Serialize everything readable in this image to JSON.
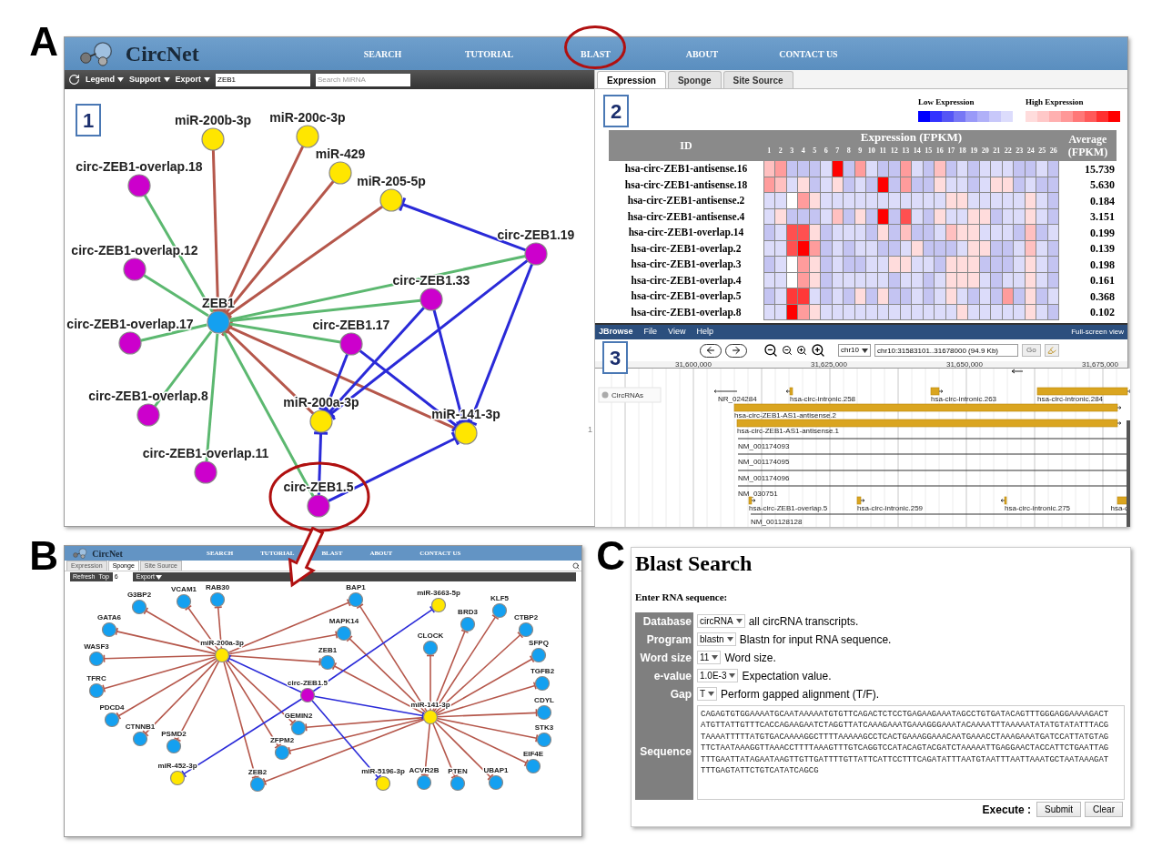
{
  "panel_a": {
    "letter": "A",
    "header": {
      "logo": "CircNet",
      "nav": [
        {
          "label": "SEARCH",
          "circled": false
        },
        {
          "label": "TUTORIAL",
          "circled": false
        },
        {
          "label": "BLAST",
          "circled": true
        },
        {
          "label": "ABOUT",
          "circled": false
        },
        {
          "label": "CONTACT US",
          "circled": false
        }
      ]
    },
    "toolbar": {
      "menus": [
        "Legend",
        "Support",
        "Export"
      ],
      "gene_field": {
        "value": "ZEB1"
      },
      "mirna_field": {
        "placeholder": "Search MiRNA"
      }
    },
    "network": {
      "box_label": "1",
      "edge_mark": "1",
      "nodes": [
        {
          "label": "miR-200b-3p",
          "color": "#ffe600",
          "circled": false
        },
        {
          "label": "miR-200c-3p",
          "color": "#ffe600",
          "circled": false
        },
        {
          "label": "miR-429",
          "color": "#ffe600",
          "circled": false
        },
        {
          "label": "miR-205-5p",
          "color": "#ffe600",
          "circled": false
        },
        {
          "label": "circ-ZEB1-overlap.18",
          "color": "#cc00cc",
          "circled": false
        },
        {
          "label": "circ-ZEB1-overlap.12",
          "color": "#cc00cc",
          "circled": false
        },
        {
          "label": "ZEB1",
          "color": "#14a0f0",
          "circled": false
        },
        {
          "label": "circ-ZEB1.19",
          "color": "#cc00cc",
          "circled": false
        },
        {
          "label": "circ-ZEB1.33",
          "color": "#cc00cc",
          "circled": false
        },
        {
          "label": "circ-ZEB1-overlap.17",
          "color": "#cc00cc",
          "circled": false
        },
        {
          "label": "circ-ZEB1.17",
          "color": "#cc00cc",
          "circled": false
        },
        {
          "label": "circ-ZEB1-overlap.8",
          "color": "#cc00cc",
          "circled": false
        },
        {
          "label": "miR-200a-3p",
          "color": "#ffe600",
          "circled": false
        },
        {
          "label": "miR-141-3p",
          "color": "#ffe600",
          "circled": false
        },
        {
          "label": "circ-ZEB1-overlap.11",
          "color": "#cc00cc",
          "circled": false
        },
        {
          "label": "circ-ZEB1.5",
          "color": "#cc00cc",
          "circled": true
        }
      ],
      "edges": [
        {
          "kind": "targets"
        },
        {
          "kind": "targets"
        },
        {
          "kind": "targets"
        },
        {
          "kind": "targets"
        },
        {
          "kind": "targets"
        },
        {
          "kind": "targets"
        },
        {
          "kind": "coexpression"
        },
        {
          "kind": "coexpression"
        },
        {
          "kind": "coexpression"
        },
        {
          "kind": "coexpression"
        },
        {
          "kind": "coexpression"
        },
        {
          "kind": "coexpression"
        },
        {
          "kind": "coexpression"
        },
        {
          "kind": "coexpression"
        },
        {
          "kind": "coexpression"
        },
        {
          "kind": "sponge"
        },
        {
          "kind": "sponge"
        },
        {
          "kind": "sponge"
        },
        {
          "kind": "sponge"
        },
        {
          "kind": "sponge"
        },
        {
          "kind": "sponge"
        },
        {
          "kind": "sponge"
        },
        {
          "kind": "sponge"
        },
        {
          "kind": "sponge"
        }
      ]
    },
    "expression": {
      "tabs": [
        {
          "label": "Expression",
          "selected": true
        },
        {
          "label": "Sponge",
          "selected": false
        },
        {
          "label": "Site Source",
          "selected": false
        }
      ],
      "box_label": "2",
      "legend": [
        {
          "label": "Low Expression",
          "swatches": [
            {
              "color": "#0000ff"
            },
            {
              "color": "#3333ff"
            },
            {
              "color": "#5555f5"
            },
            {
              "color": "#7777f5"
            },
            {
              "color": "#9999f8"
            },
            {
              "color": "#b0b0f8"
            },
            {
              "color": "#c8c8fa"
            },
            {
              "color": "#dcdcfc"
            }
          ]
        },
        {
          "label": "High Expression",
          "swatches": [
            {
              "color": "#ffdcdc"
            },
            {
              "color": "#ffc8c8"
            },
            {
              "color": "#ffb0b0"
            },
            {
              "color": "#ff9898"
            },
            {
              "color": "#ff7878"
            },
            {
              "color": "#ff5a5a"
            },
            {
              "color": "#ff3030"
            },
            {
              "color": "#ff0000"
            }
          ]
        }
      ],
      "table": {
        "id_header": "ID",
        "expression_header": "Expression (FPKM)",
        "average_header": [
          "Average",
          "(FPKM)"
        ],
        "columns": [
          "1",
          "2",
          "3",
          "4",
          "5",
          "6",
          "7",
          "8",
          "9",
          "10",
          "11",
          "12",
          "13",
          "14",
          "15",
          "16",
          "17",
          "18",
          "19",
          "20",
          "21",
          "22",
          "23",
          "24",
          "25",
          "26"
        ],
        "rows": [
          {
            "id": "hsa-circ-ZEB1-antisense.16",
            "average": "15.739",
            "cells": [
              {
                "color": "#ffc0c0"
              },
              {
                "color": "#ff9c9c"
              },
              {
                "color": "#c4c4f2"
              },
              {
                "color": "#c4c4f2"
              },
              {
                "color": "#c4c4f2"
              },
              {
                "color": "#dcdcfa"
              },
              {
                "color": "#ff0000"
              },
              {
                "color": "#c4c4f2"
              },
              {
                "color": "#ff9c9c"
              },
              {
                "color": "#dcdcfa"
              },
              {
                "color": "#c4c4f2"
              },
              {
                "color": "#c4c4f2"
              },
              {
                "color": "#ff9c9c"
              },
              {
                "color": "#dcdcfa"
              },
              {
                "color": "#c4c4f2"
              },
              {
                "color": "#ffc0c0"
              },
              {
                "color": "#c4c4f2"
              },
              {
                "color": "#dcdcfa"
              },
              {
                "color": "#c4c4f2"
              },
              {
                "color": "#dcdcfa"
              },
              {
                "color": "#dcdcfa"
              },
              {
                "color": "#dcdcfa"
              },
              {
                "color": "#c4c4f2"
              },
              {
                "color": "#c4c4f2"
              },
              {
                "color": "#dcdcfa"
              },
              {
                "color": "#c4c4f2"
              }
            ]
          },
          {
            "id": "hsa-circ-ZEB1-antisense.18",
            "average": "5.630",
            "cells": [
              {
                "color": "#ff9c9c"
              },
              {
                "color": "#ffc0c0"
              },
              {
                "color": "#dcdcfa"
              },
              {
                "color": "#ffdcdc"
              },
              {
                "color": "#c4c4f2"
              },
              {
                "color": "#dcdcfa"
              },
              {
                "color": "#ffdcdc"
              },
              {
                "color": "#c4c4f2"
              },
              {
                "color": "#dcdcfa"
              },
              {
                "color": "#c4c4f2"
              },
              {
                "color": "#ff0000"
              },
              {
                "color": "#c4c4f2"
              },
              {
                "color": "#ff9c9c"
              },
              {
                "color": "#c4c4f2"
              },
              {
                "color": "#c4c4f2"
              },
              {
                "color": "#ffdcdc"
              },
              {
                "color": "#dcdcfa"
              },
              {
                "color": "#dcdcfa"
              },
              {
                "color": "#c4c4f2"
              },
              {
                "color": "#dcdcfa"
              },
              {
                "color": "#ffdcdc"
              },
              {
                "color": "#ffdcdc"
              },
              {
                "color": "#c4c4f2"
              },
              {
                "color": "#dcdcfa"
              },
              {
                "color": "#c4c4f2"
              },
              {
                "color": "#c4c4f2"
              }
            ]
          },
          {
            "id": "hsa-circ-ZEB1-antisense.2",
            "average": "0.184",
            "cells": [
              {
                "color": "#dcdcfa"
              },
              {
                "color": "#dcdcfa"
              },
              {
                "color": "#ffffff"
              },
              {
                "color": "#ff9c9c"
              },
              {
                "color": "#ffdcdc"
              },
              {
                "color": "#dcdcfa"
              },
              {
                "color": "#dcdcfa"
              },
              {
                "color": "#dcdcfa"
              },
              {
                "color": "#dcdcfa"
              },
              {
                "color": "#dcdcfa"
              },
              {
                "color": "#dcdcfa"
              },
              {
                "color": "#dcdcfa"
              },
              {
                "color": "#dcdcfa"
              },
              {
                "color": "#dcdcfa"
              },
              {
                "color": "#dcdcfa"
              },
              {
                "color": "#dcdcfa"
              },
              {
                "color": "#ffdcdc"
              },
              {
                "color": "#ffdcdc"
              },
              {
                "color": "#dcdcfa"
              },
              {
                "color": "#dcdcfa"
              },
              {
                "color": "#dcdcfa"
              },
              {
                "color": "#dcdcfa"
              },
              {
                "color": "#dcdcfa"
              },
              {
                "color": "#ffdcdc"
              },
              {
                "color": "#dcdcfa"
              },
              {
                "color": "#c4c4f2"
              }
            ]
          },
          {
            "id": "hsa-circ-ZEB1-antisense.4",
            "average": "3.151",
            "cells": [
              {
                "color": "#dcdcfa"
              },
              {
                "color": "#ffdcdc"
              },
              {
                "color": "#c4c4f2"
              },
              {
                "color": "#c4c4f2"
              },
              {
                "color": "#c4c4f2"
              },
              {
                "color": "#dcdcfa"
              },
              {
                "color": "#ffc0c0"
              },
              {
                "color": "#c4c4f2"
              },
              {
                "color": "#ffdcdc"
              },
              {
                "color": "#c4c4f2"
              },
              {
                "color": "#ff0000"
              },
              {
                "color": "#c4c4f2"
              },
              {
                "color": "#ff5050"
              },
              {
                "color": "#dcdcfa"
              },
              {
                "color": "#c4c4f2"
              },
              {
                "color": "#ffdcdc"
              },
              {
                "color": "#dcdcfa"
              },
              {
                "color": "#dcdcfa"
              },
              {
                "color": "#ffdcdc"
              },
              {
                "color": "#ffdcdc"
              },
              {
                "color": "#c4c4f2"
              },
              {
                "color": "#dcdcfa"
              },
              {
                "color": "#dcdcfa"
              },
              {
                "color": "#ffdcdc"
              },
              {
                "color": "#dcdcfa"
              },
              {
                "color": "#c4c4f2"
              }
            ]
          },
          {
            "id": "hsa-circ-ZEB1-overlap.14",
            "average": "0.199",
            "cells": [
              {
                "color": "#c4c4f2"
              },
              {
                "color": "#dcdcfa"
              },
              {
                "color": "#ff5050"
              },
              {
                "color": "#ff5050"
              },
              {
                "color": "#ffdcdc"
              },
              {
                "color": "#c4c4f2"
              },
              {
                "color": "#dcdcfa"
              },
              {
                "color": "#dcdcfa"
              },
              {
                "color": "#dcdcfa"
              },
              {
                "color": "#c4c4f2"
              },
              {
                "color": "#ffdcdc"
              },
              {
                "color": "#c4c4f2"
              },
              {
                "color": "#ffc0c0"
              },
              {
                "color": "#c4c4f2"
              },
              {
                "color": "#c4c4f2"
              },
              {
                "color": "#dcdcfa"
              },
              {
                "color": "#ffc0c0"
              },
              {
                "color": "#ffdcdc"
              },
              {
                "color": "#ffdcdc"
              },
              {
                "color": "#dcdcfa"
              },
              {
                "color": "#dcdcfa"
              },
              {
                "color": "#dcdcfa"
              },
              {
                "color": "#c4c4f2"
              },
              {
                "color": "#ffc0c0"
              },
              {
                "color": "#c4c4f2"
              },
              {
                "color": "#dcdcfa"
              }
            ]
          },
          {
            "id": "hsa-circ-ZEB1-overlap.2",
            "average": "0.139",
            "cells": [
              {
                "color": "#dcdcfa"
              },
              {
                "color": "#dcdcfa"
              },
              {
                "color": "#ff5050"
              },
              {
                "color": "#ff0000"
              },
              {
                "color": "#ff9c9c"
              },
              {
                "color": "#c4c4f2"
              },
              {
                "color": "#dcdcfa"
              },
              {
                "color": "#c4c4f2"
              },
              {
                "color": "#dcdcfa"
              },
              {
                "color": "#dcdcfa"
              },
              {
                "color": "#c4c4f2"
              },
              {
                "color": "#c4c4f2"
              },
              {
                "color": "#dcdcfa"
              },
              {
                "color": "#ffdcdc"
              },
              {
                "color": "#c4c4f2"
              },
              {
                "color": "#c4c4f2"
              },
              {
                "color": "#c4c4f2"
              },
              {
                "color": "#dcdcfa"
              },
              {
                "color": "#ffdcdc"
              },
              {
                "color": "#ffdcdc"
              },
              {
                "color": "#c4c4f2"
              },
              {
                "color": "#c4c4f2"
              },
              {
                "color": "#dcdcfa"
              },
              {
                "color": "#ffc0c0"
              },
              {
                "color": "#dcdcfa"
              },
              {
                "color": "#c4c4f2"
              }
            ]
          },
          {
            "id": "hsa-circ-ZEB1-overlap.3",
            "average": "0.198",
            "cells": [
              {
                "color": "#c4c4f2"
              },
              {
                "color": "#dcdcfa"
              },
              {
                "color": "#ffffff"
              },
              {
                "color": "#ff9c9c"
              },
              {
                "color": "#ffdcdc"
              },
              {
                "color": "#c4c4f2"
              },
              {
                "color": "#dcdcfa"
              },
              {
                "color": "#c4c4f2"
              },
              {
                "color": "#c4c4f2"
              },
              {
                "color": "#dcdcfa"
              },
              {
                "color": "#dcdcfa"
              },
              {
                "color": "#ffdcdc"
              },
              {
                "color": "#ffdcdc"
              },
              {
                "color": "#dcdcfa"
              },
              {
                "color": "#dcdcfa"
              },
              {
                "color": "#c4c4f2"
              },
              {
                "color": "#ffdcdc"
              },
              {
                "color": "#ffdcdc"
              },
              {
                "color": "#ffdcdc"
              },
              {
                "color": "#c4c4f2"
              },
              {
                "color": "#c4c4f2"
              },
              {
                "color": "#c4c4f2"
              },
              {
                "color": "#dcdcfa"
              },
              {
                "color": "#ffdcdc"
              },
              {
                "color": "#dcdcfa"
              },
              {
                "color": "#c4c4f2"
              }
            ]
          },
          {
            "id": "hsa-circ-ZEB1-overlap.4",
            "average": "0.161",
            "cells": [
              {
                "color": "#dcdcfa"
              },
              {
                "color": "#dcdcfa"
              },
              {
                "color": "#ffffff"
              },
              {
                "color": "#ff9c9c"
              },
              {
                "color": "#ffdcdc"
              },
              {
                "color": "#c4c4f2"
              },
              {
                "color": "#dcdcfa"
              },
              {
                "color": "#dcdcfa"
              },
              {
                "color": "#dcdcfa"
              },
              {
                "color": "#dcdcfa"
              },
              {
                "color": "#dcdcfa"
              },
              {
                "color": "#c4c4f2"
              },
              {
                "color": "#dcdcfa"
              },
              {
                "color": "#dcdcfa"
              },
              {
                "color": "#c4c4f2"
              },
              {
                "color": "#dcdcfa"
              },
              {
                "color": "#ffdcdc"
              },
              {
                "color": "#ffdcdc"
              },
              {
                "color": "#ffdcdc"
              },
              {
                "color": "#dcdcfa"
              },
              {
                "color": "#c4c4f2"
              },
              {
                "color": "#dcdcfa"
              },
              {
                "color": "#dcdcfa"
              },
              {
                "color": "#ffdcdc"
              },
              {
                "color": "#dcdcfa"
              },
              {
                "color": "#c4c4f2"
              }
            ]
          },
          {
            "id": "hsa-circ-ZEB1-overlap.5",
            "average": "0.368",
            "cells": [
              {
                "color": "#c4c4f2"
              },
              {
                "color": "#dcdcfa"
              },
              {
                "color": "#ff3838"
              },
              {
                "color": "#ff3838"
              },
              {
                "color": "#dcdcfa"
              },
              {
                "color": "#c4c4f2"
              },
              {
                "color": "#dcdcfa"
              },
              {
                "color": "#c4c4f2"
              },
              {
                "color": "#ffdcdc"
              },
              {
                "color": "#c4c4f2"
              },
              {
                "color": "#ffdcdc"
              },
              {
                "color": "#c4c4f2"
              },
              {
                "color": "#c4c4f2"
              },
              {
                "color": "#dcdcfa"
              },
              {
                "color": "#c4c4f2"
              },
              {
                "color": "#dcdcfa"
              },
              {
                "color": "#ffdcdc"
              },
              {
                "color": "#dcdcfa"
              },
              {
                "color": "#c4c4f2"
              },
              {
                "color": "#dcdcfa"
              },
              {
                "color": "#c4c4f2"
              },
              {
                "color": "#ff9c9c"
              },
              {
                "color": "#c4c4f2"
              },
              {
                "color": "#ffdcdc"
              },
              {
                "color": "#c4c4f2"
              },
              {
                "color": "#dcdcfa"
              }
            ]
          },
          {
            "id": "hsa-circ-ZEB1-overlap.8",
            "average": "0.102",
            "cells": [
              {
                "color": "#dcdcfa"
              },
              {
                "color": "#dcdcfa"
              },
              {
                "color": "#ff0000"
              },
              {
                "color": "#ff9c9c"
              },
              {
                "color": "#ffdcdc"
              },
              {
                "color": "#dcdcfa"
              },
              {
                "color": "#dcdcfa"
              },
              {
                "color": "#dcdcfa"
              },
              {
                "color": "#dcdcfa"
              },
              {
                "color": "#dcdcfa"
              },
              {
                "color": "#dcdcfa"
              },
              {
                "color": "#dcdcfa"
              },
              {
                "color": "#dcdcfa"
              },
              {
                "color": "#dcdcfa"
              },
              {
                "color": "#dcdcfa"
              },
              {
                "color": "#dcdcfa"
              },
              {
                "color": "#dcdcfa"
              },
              {
                "color": "#ffdcdc"
              },
              {
                "color": "#dcdcfa"
              },
              {
                "color": "#dcdcfa"
              },
              {
                "color": "#dcdcfa"
              },
              {
                "color": "#dcdcfa"
              },
              {
                "color": "#dcdcfa"
              },
              {
                "color": "#ffdcdc"
              },
              {
                "color": "#dcdcfa"
              },
              {
                "color": "#c4c4f2"
              }
            ]
          }
        ]
      }
    },
    "jbrowse": {
      "menu": [
        "File",
        "View",
        "Help"
      ],
      "brand": "JBrowse",
      "fullscreen": "Full-screen view",
      "box_label": "3",
      "chromosome": "chr10",
      "location": "chr10:31583101..31678000 (94.9 Kb)",
      "go": "Go",
      "ruler": [
        "31,600,000",
        "31,625,000",
        "31,650,000",
        "31,675,000"
      ],
      "track": "CircRNAs",
      "features": [
        {
          "label": "NR_024284",
          "kind": "transcript"
        },
        {
          "label": "hsa-circ-intronic.258",
          "kind": "circ"
        },
        {
          "label": "hsa-circ-intronic.263",
          "kind": "circ"
        },
        {
          "label": "hsa-circ-intronic.284",
          "kind": "circ"
        },
        {
          "label": "hsa-circ-ZEB1-AS1-antisense.2",
          "kind": "circ"
        },
        {
          "label": "hsa-circ-ZEB1-AS1-antisense.1",
          "kind": "circ"
        },
        {
          "label": "NM_001174093",
          "kind": "transcript"
        },
        {
          "label": "NM_001174095",
          "kind": "transcript"
        },
        {
          "label": "NM_001174096",
          "kind": "transcript"
        },
        {
          "label": "NM_030751",
          "kind": "transcript"
        },
        {
          "label": "hsa-circ-ZEB1-overlap.5",
          "kind": "circ"
        },
        {
          "label": "hsa-circ-intronic.259",
          "kind": "circ"
        },
        {
          "label": "hsa-circ-intronic.275",
          "kind": "circ"
        },
        {
          "label": "hsa-c",
          "kind": "circ"
        },
        {
          "label": "NM_001128128",
          "kind": "transcript"
        }
      ]
    }
  },
  "panel_b": {
    "letter": "B",
    "header": {
      "logo": "CircNet",
      "nav": [
        "SEARCH",
        "TUTORIAL",
        "BLAST",
        "ABOUT",
        "CONTACT US"
      ]
    },
    "tabs": [
      {
        "label": "Expression",
        "selected": false
      },
      {
        "label": "Sponge",
        "selected": true
      },
      {
        "label": "Site Source",
        "selected": false
      }
    ],
    "toolbar": {
      "refresh": "Refresh",
      "top_label": "Top",
      "top_value": "6",
      "export": "Export"
    },
    "network": {
      "nodes": [
        {
          "label": "miR-200a-3p",
          "color": "#ffe600"
        },
        {
          "label": "miR-141-3p",
          "color": "#ffe600"
        },
        {
          "label": "circ-ZEB1.5",
          "color": "#cc00cc"
        },
        {
          "label": "miR-3663-5p",
          "color": "#ffe600"
        },
        {
          "label": "miR-452-3p",
          "color": "#ffe600"
        },
        {
          "label": "miR-5196-3p",
          "color": "#ffe600"
        },
        {
          "label": "G3BP2",
          "color": "#14a0f0"
        },
        {
          "label": "VCAM1",
          "color": "#14a0f0"
        },
        {
          "label": "RAB30",
          "color": "#14a0f0"
        },
        {
          "label": "GATA6",
          "color": "#14a0f0"
        },
        {
          "label": "WASF3",
          "color": "#14a0f0"
        },
        {
          "label": "TFRC",
          "color": "#14a0f0"
        },
        {
          "label": "PDCD4",
          "color": "#14a0f0"
        },
        {
          "label": "CTNNB1",
          "color": "#14a0f0"
        },
        {
          "label": "PSMD2",
          "color": "#14a0f0"
        },
        {
          "label": "ZEB2",
          "color": "#14a0f0"
        },
        {
          "label": "ZFPM2",
          "color": "#14a0f0"
        },
        {
          "label": "GEMIN2",
          "color": "#14a0f0"
        },
        {
          "label": "ZEB1",
          "color": "#14a0f0"
        },
        {
          "label": "MAPK14",
          "color": "#14a0f0"
        },
        {
          "label": "BAP1",
          "color": "#14a0f0"
        },
        {
          "label": "CLOCK",
          "color": "#14a0f0"
        },
        {
          "label": "BRD3",
          "color": "#14a0f0"
        },
        {
          "label": "KLF5",
          "color": "#14a0f0"
        },
        {
          "label": "CTBP2",
          "color": "#14a0f0"
        },
        {
          "label": "SFPQ",
          "color": "#14a0f0"
        },
        {
          "label": "TGFB2",
          "color": "#14a0f0"
        },
        {
          "label": "CDYL",
          "color": "#14a0f0"
        },
        {
          "label": "STK3",
          "color": "#14a0f0"
        },
        {
          "label": "EIF4E",
          "color": "#14a0f0"
        },
        {
          "label": "ACVR2B",
          "color": "#14a0f0"
        },
        {
          "label": "PTEN",
          "color": "#14a0f0"
        },
        {
          "label": "UBAP1",
          "color": "#14a0f0"
        }
      ],
      "edges": [
        {
          "kind": "targets"
        },
        {
          "kind": "targets"
        },
        {
          "kind": "targets"
        },
        {
          "kind": "targets"
        },
        {
          "kind": "targets"
        },
        {
          "kind": "targets"
        },
        {
          "kind": "targets"
        },
        {
          "kind": "targets"
        },
        {
          "kind": "targets"
        },
        {
          "kind": "targets"
        },
        {
          "kind": "targets"
        },
        {
          "kind": "targets"
        },
        {
          "kind": "targets"
        },
        {
          "kind": "targets"
        },
        {
          "kind": "targets"
        },
        {
          "kind": "targets"
        },
        {
          "kind": "targets"
        },
        {
          "kind": "targets"
        },
        {
          "kind": "targets"
        },
        {
          "kind": "targets"
        },
        {
          "kind": "targets"
        },
        {
          "kind": "targets"
        },
        {
          "kind": "targets"
        },
        {
          "kind": "targets"
        },
        {
          "kind": "targets"
        },
        {
          "kind": "targets"
        },
        {
          "kind": "targets"
        },
        {
          "kind": "targets"
        },
        {
          "kind": "targets"
        },
        {
          "kind": "targets"
        },
        {
          "kind": "targets"
        },
        {
          "kind": "targets"
        },
        {
          "kind": "targets"
        },
        {
          "kind": "sponge"
        },
        {
          "kind": "sponge"
        },
        {
          "kind": "sponge"
        },
        {
          "kind": "sponge"
        },
        {
          "kind": "sponge"
        }
      ]
    }
  },
  "panel_c": {
    "letter": "C",
    "title": "Blast Search",
    "subtitle": "Enter RNA sequence:",
    "rows": [
      {
        "kind": "select",
        "label": "Database",
        "value": "circRNA",
        "description": "all circRNA transcripts."
      },
      {
        "kind": "select",
        "label": "Program",
        "value": "blastn",
        "description": "Blastn for input RNA sequence."
      },
      {
        "kind": "select",
        "label": "Word size",
        "value": "11",
        "description": "Word size."
      },
      {
        "kind": "select",
        "label": "e-value",
        "value": "1.0E-3",
        "description": "Expectation value."
      },
      {
        "kind": "select",
        "label": "Gap",
        "value": "T",
        "description": "Perform gapped alignment (T/F)."
      },
      {
        "kind": "sequence",
        "label": "Sequence",
        "lines": [
          "CAGAGTGTGGAAAATGCAATAAAAATGTGTTCAGACTCTCCTGAGAAGAAATAGCCTGTGATACAGTTTGGGAGGAAAAGACT",
          "ATGTTATTGTTTCACCAGAAGAATCTAGGTTATCAAAGAAATGAAAGGGAAATACAAAATTTAAAAATATATGTATATTTACG",
          "TAAAATTTTTATGTGACAAAAGGCTTTTAAAAAGCCTCACTGAAAGGAAACAATGAAACCTAAAGAAATGATCCATTATGTAG",
          "TTCTAATAAAGGTTAAACCTTTTAAAGTTTGTCAGGTCCATACAGTACGATCTAAAAATTGAGGAACTACCATTCTGAATTAG",
          "TTTGAATTATAGAATAAGTTGTTGATTTTGTTATTCATTCCTTTCAGATATTTAATGTAATTTAATTAAATGCTAATAAAGAT",
          "TTTGAGTATTCTGTCATATCAGCG"
        ]
      }
    ],
    "execute_label": "Execute :",
    "buttons": [
      "Submit",
      "Clear"
    ]
  }
}
